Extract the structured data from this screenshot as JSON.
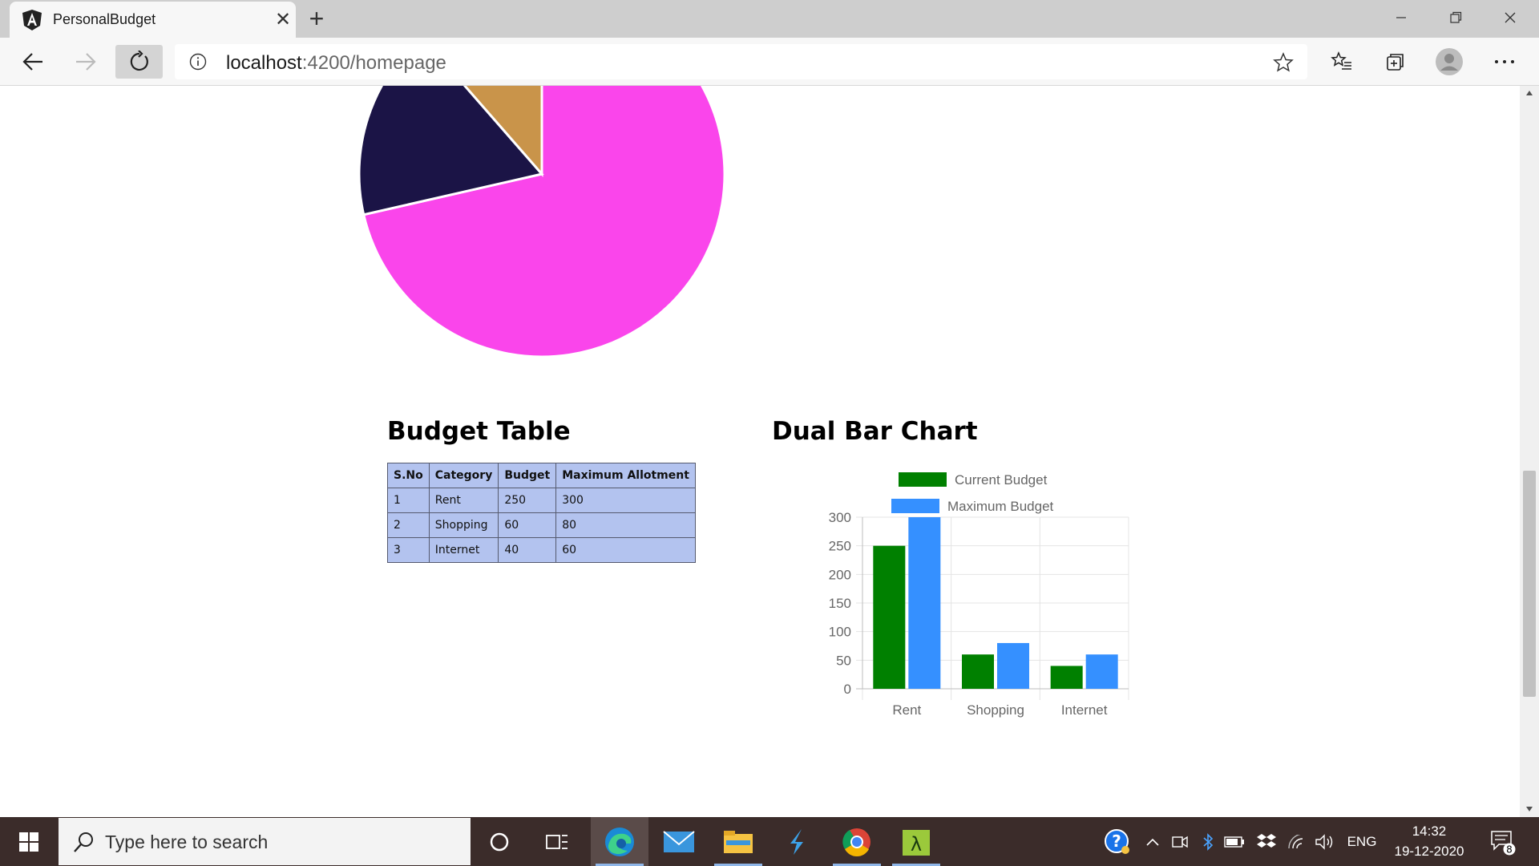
{
  "browser": {
    "tab_title": "PersonalBudget",
    "url_host": "localhost",
    "url_rest": ":4200/homepage"
  },
  "budget_table": {
    "title": "Budget Table",
    "headers": [
      "S.No",
      "Category",
      "Budget",
      "Maximum Allotment"
    ],
    "rows": [
      [
        "1",
        "Rent",
        "250",
        "300"
      ],
      [
        "2",
        "Shopping",
        "60",
        "80"
      ],
      [
        "3",
        "Internet",
        "40",
        "60"
      ]
    ]
  },
  "dual_bar_chart": {
    "title": "Dual Bar Chart"
  },
  "chart_data": [
    {
      "type": "pie",
      "categories": [
        "Rent",
        "Shopping",
        "Internet"
      ],
      "values": [
        250,
        60,
        40
      ],
      "colors": [
        "#fa45eb",
        "#1b1446",
        "#c9944a"
      ],
      "partially_visible": true
    },
    {
      "type": "bar",
      "categories": [
        "Rent",
        "Shopping",
        "Internet"
      ],
      "series": [
        {
          "name": "Current Budget",
          "values": [
            250,
            60,
            40
          ],
          "color": "#008000"
        },
        {
          "name": "Maximum Budget",
          "values": [
            300,
            80,
            60
          ],
          "color": "#3590ff"
        }
      ],
      "ylim": [
        0,
        300
      ],
      "yticks": [
        "300",
        "250",
        "200",
        "150",
        "100",
        "50",
        "0"
      ],
      "grid": true,
      "legend_position": "top"
    }
  ],
  "taskbar": {
    "search_placeholder": "Type here to search",
    "language": "ENG",
    "time": "14:32",
    "date": "19-12-2020",
    "notification_count": "8"
  }
}
